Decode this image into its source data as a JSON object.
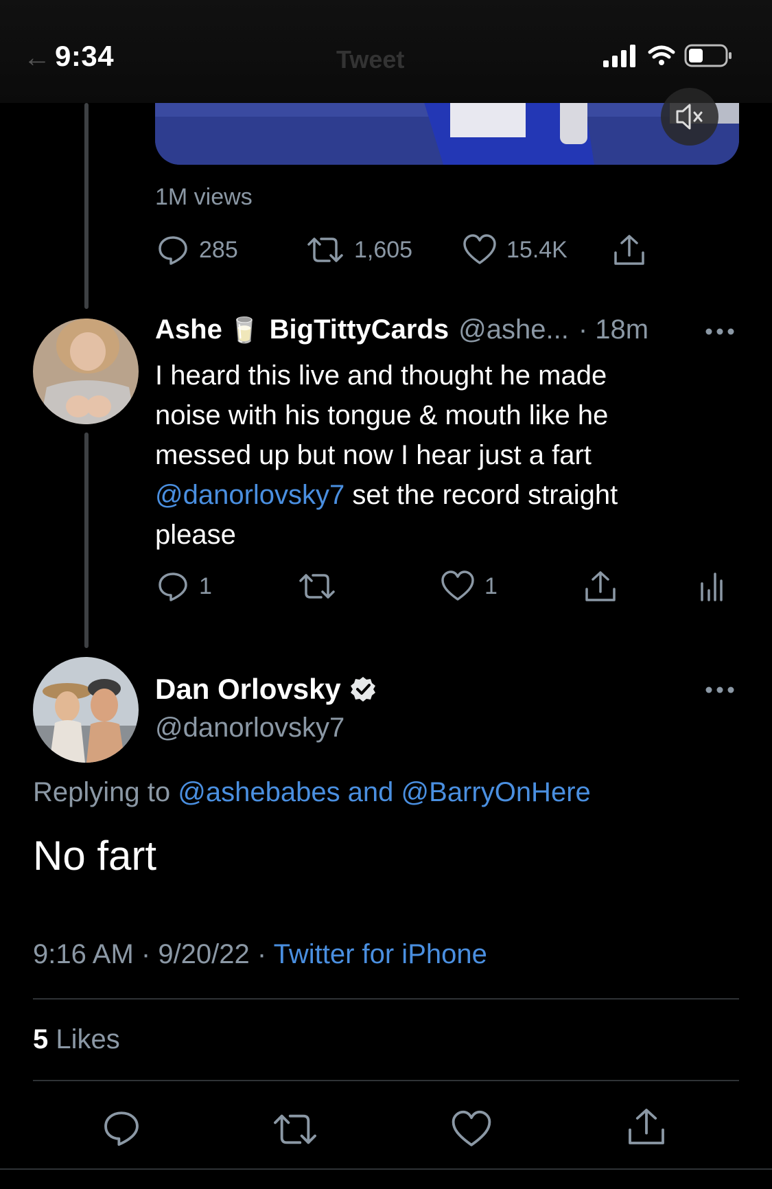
{
  "status_bar": {
    "time": "9:34",
    "header_title": "Tweet"
  },
  "media": {
    "mute_icon": "mute-icon"
  },
  "prev_tweet": {
    "views": "1M views",
    "reply_count": "285",
    "retweet_count": "1,605",
    "like_count": "15.4K"
  },
  "reply_tweet": {
    "display_name": "Ashe",
    "emoji": "🥛",
    "display_name_suffix": "BigTittyCards",
    "handle": "@ashe...",
    "time_ago": "· 18m",
    "text_line1": "I heard this live and thought he made",
    "text_line2": "noise with his tongue & mouth like he",
    "text_line3": "messed up but now I hear just a fart",
    "mention": "@danorlovsky7",
    "text_line4_rest": " set the record straight",
    "text_line5": "please",
    "reply_count": "1",
    "retweet_count": "",
    "like_count": "1"
  },
  "main_tweet": {
    "display_name": "Dan Orlovsky",
    "handle": "@danorlovsky7",
    "replying_to_label": "Replying to ",
    "replying_to_users": "@ashebabes and @BarryOnHere",
    "text": "No fart",
    "time": "9:16 AM",
    "date": "· 9/20/22 ·",
    "source": "Twitter for iPhone",
    "likes_count": "5",
    "likes_label": " Likes"
  },
  "colors": {
    "link": "#4a8fe0",
    "muted": "#8b98a5",
    "background": "#000000"
  }
}
